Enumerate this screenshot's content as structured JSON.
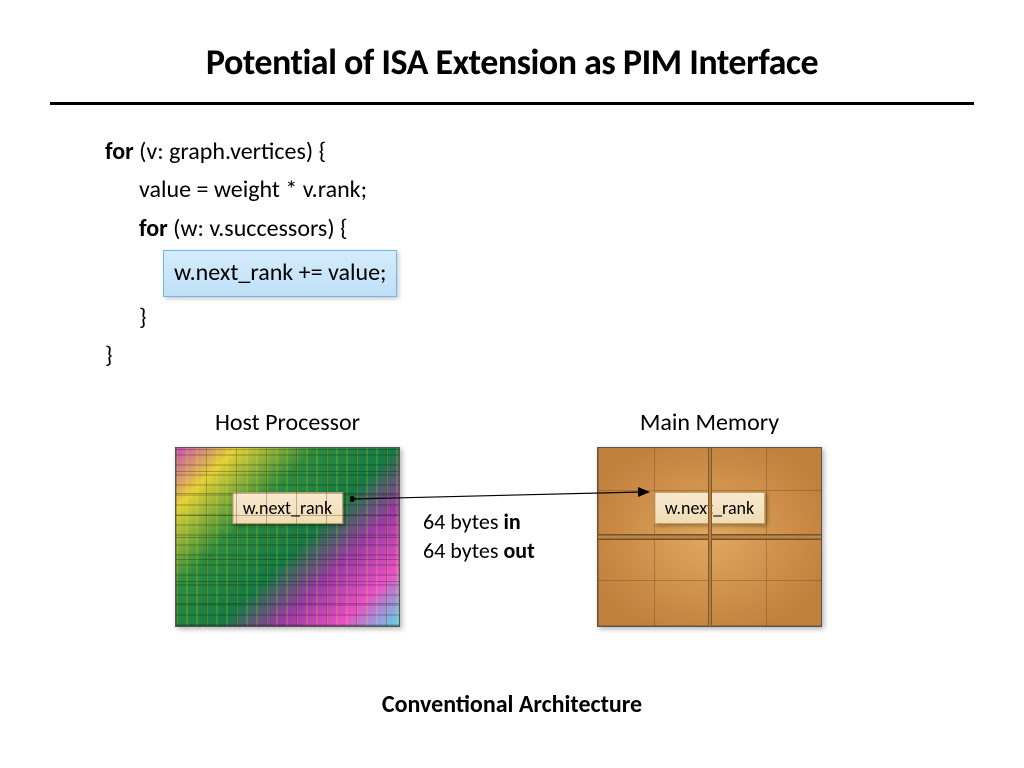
{
  "title": "Potential of ISA Extension as PIM Interface",
  "code": {
    "l1_kw": "for",
    "l1_rest": " (v: graph.vertices) {",
    "l2": "value = weight * v.rank;",
    "l3_kw": "for",
    "l3_rest": " (w: v.successors) {",
    "l4_highlight": "w.next_rank += value;",
    "l5": "}",
    "l6": "}"
  },
  "figure": {
    "host_label": "Host Processor",
    "mem_label": "Main Memory",
    "host_badge": "w.next_rank",
    "mem_badge": "w.next_rank",
    "transfer_in_num": "64 bytes ",
    "transfer_in_b": "in",
    "transfer_out_num": "64 bytes ",
    "transfer_out_b": "out"
  },
  "footer": "Conventional Architecture"
}
